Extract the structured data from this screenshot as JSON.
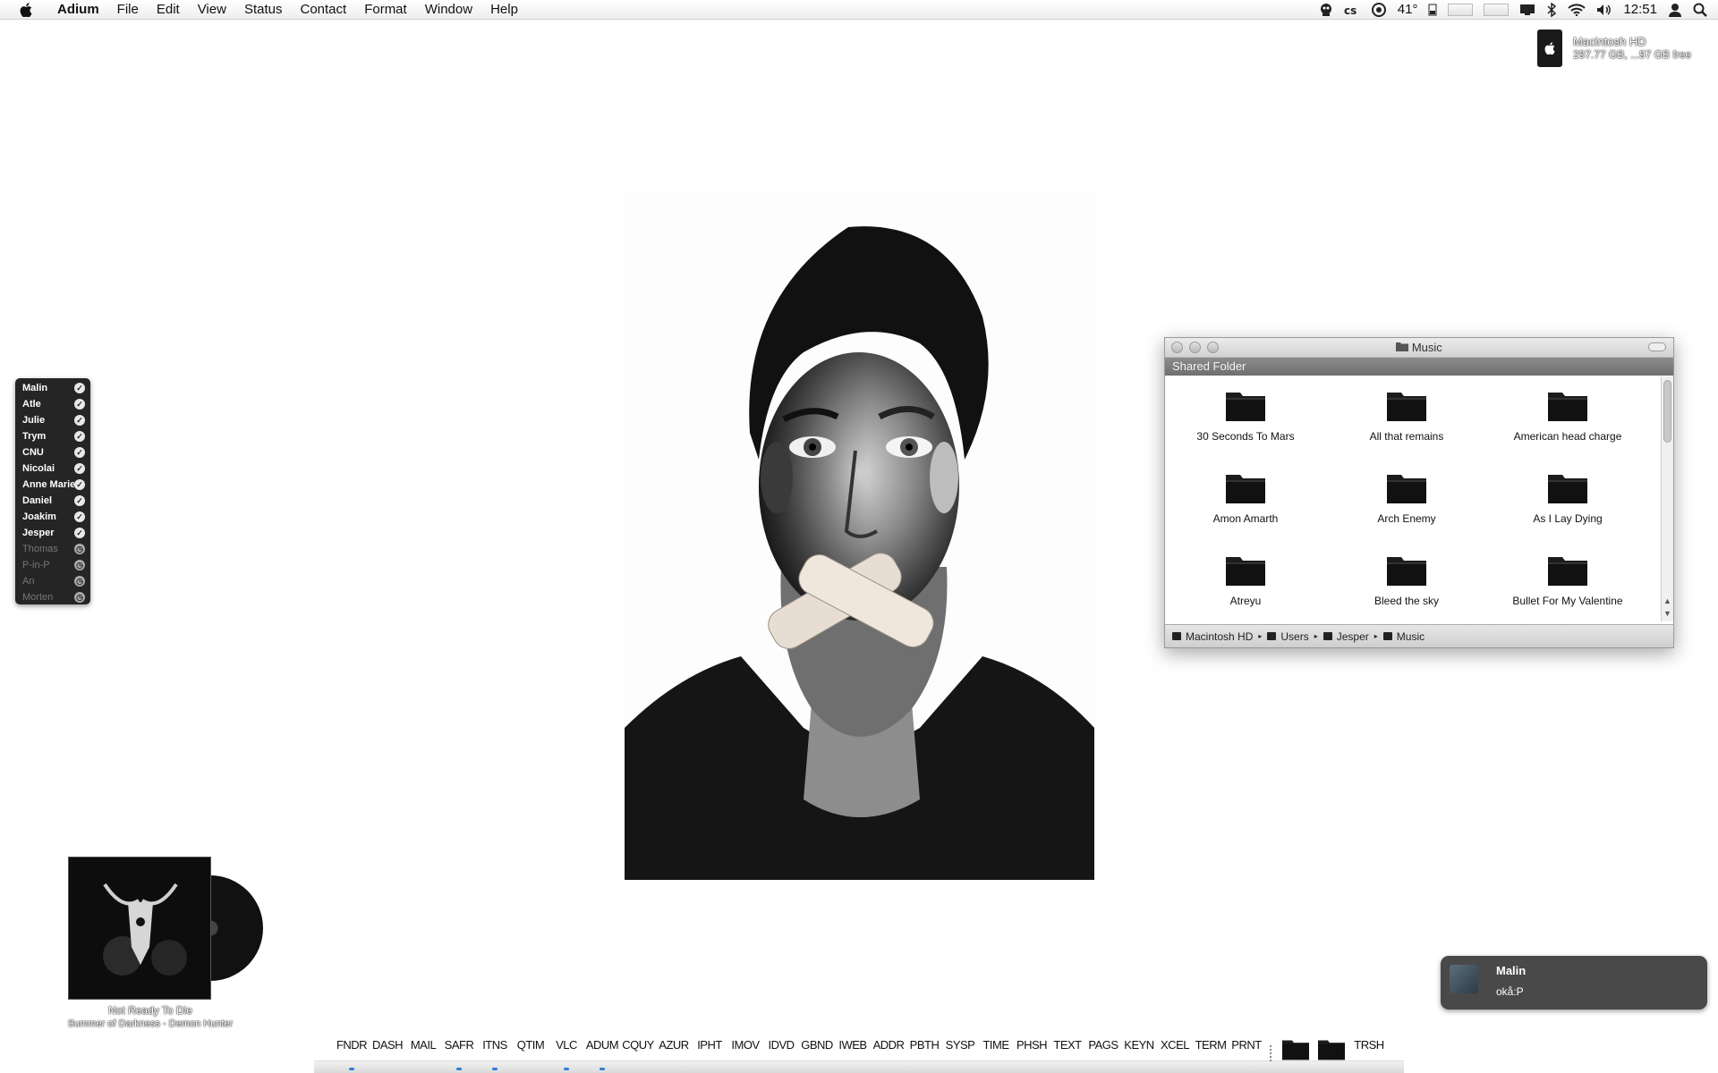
{
  "menubar": {
    "app_name": "Adium",
    "items": [
      "File",
      "Edit",
      "View",
      "Status",
      "Contact",
      "Format",
      "Window",
      "Help"
    ],
    "temperature": "41°",
    "clock": "12:51"
  },
  "drive": {
    "name": "Macintosh HD",
    "info": "297.77 GB, ...97 GB free"
  },
  "buddies": [
    {
      "name": "Malin",
      "online": true
    },
    {
      "name": "Atle",
      "online": true
    },
    {
      "name": "Julie",
      "online": true
    },
    {
      "name": "Trym",
      "online": true
    },
    {
      "name": "CNU",
      "online": true
    },
    {
      "name": "Nicolai",
      "online": true
    },
    {
      "name": "Anne Marie",
      "online": true
    },
    {
      "name": "Daniel",
      "online": true
    },
    {
      "name": "Joakim",
      "online": true
    },
    {
      "name": "Jesper",
      "online": true
    },
    {
      "name": "Thomas",
      "online": false
    },
    {
      "name": "P-in-P",
      "online": false
    },
    {
      "name": "An",
      "online": false
    },
    {
      "name": "Morten",
      "online": false
    }
  ],
  "finder": {
    "title": "Music",
    "shared_label": "Shared Folder",
    "folders": [
      "30 Seconds To Mars",
      "All that remains",
      "American head charge",
      "Amon Amarth",
      "Arch Enemy",
      "As I Lay Dying",
      "Atreyu",
      "Bleed the sky",
      "Bullet For My Valentine"
    ],
    "path": [
      "Macintosh HD",
      "Users",
      "Jesper",
      "Music"
    ]
  },
  "now_playing": {
    "title": "Not Ready To Die",
    "subtitle": "Summer of Darkness - Demon Hunter"
  },
  "notification": {
    "title": "Malin",
    "message": "okå:P"
  },
  "dock": {
    "apps": [
      {
        "label": "FNDR",
        "running": true
      },
      {
        "label": "DASH",
        "running": false
      },
      {
        "label": "MAIL",
        "running": false
      },
      {
        "label": "SAFR",
        "running": true
      },
      {
        "label": "ITNS",
        "running": true
      },
      {
        "label": "QTIM",
        "running": false
      },
      {
        "label": "VLC",
        "running": true
      },
      {
        "label": "ADUM",
        "running": true
      },
      {
        "label": "CQUY",
        "running": false
      },
      {
        "label": "AZUR",
        "running": false
      },
      {
        "label": "IPHT",
        "running": false
      },
      {
        "label": "IMOV",
        "running": false
      },
      {
        "label": "IDVD",
        "running": false
      },
      {
        "label": "GBND",
        "running": false
      },
      {
        "label": "IWEB",
        "running": false
      },
      {
        "label": "ADDR",
        "running": false
      },
      {
        "label": "PBTH",
        "running": false
      },
      {
        "label": "SYSP",
        "running": false
      },
      {
        "label": "TIME",
        "running": false
      },
      {
        "label": "PHSH",
        "running": false
      },
      {
        "label": "TEXT",
        "running": false
      },
      {
        "label": "PAGS",
        "running": false
      },
      {
        "label": "KEYN",
        "running": false
      },
      {
        "label": "XCEL",
        "running": false
      },
      {
        "label": "TERM",
        "running": false
      },
      {
        "label": "PRNT",
        "running": false
      }
    ],
    "trash_label": "TRSH"
  }
}
